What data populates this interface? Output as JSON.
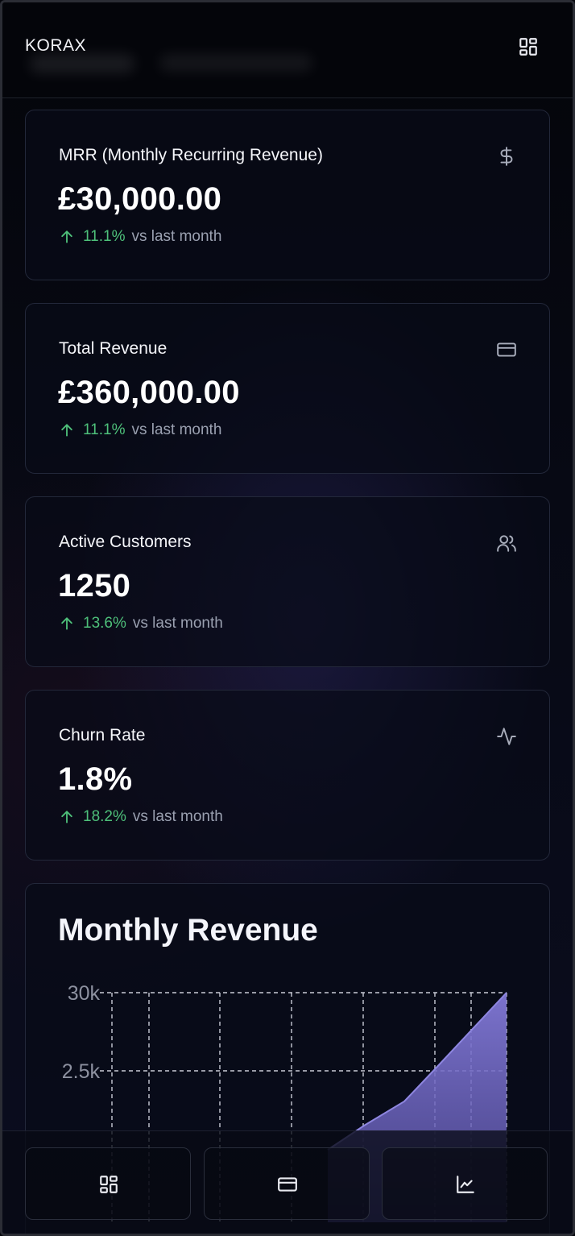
{
  "header": {
    "brand": "KORAX",
    "menu_icon": "dashboard-grid-icon"
  },
  "stats": [
    {
      "label": "MRR (Monthly Recurring Revenue)",
      "value": "£30,000.00",
      "change": "11.1%",
      "comparison": "vs last month",
      "icon": "dollar-icon",
      "trend": "up"
    },
    {
      "label": "Total Revenue",
      "value": "£360,000.00",
      "change": "11.1%",
      "comparison": "vs last month",
      "icon": "credit-card-icon",
      "trend": "up"
    },
    {
      "label": "Active Customers",
      "value": "1250",
      "change": "13.6%",
      "comparison": "vs last month",
      "icon": "users-icon",
      "trend": "up"
    },
    {
      "label": "Churn Rate",
      "value": "1.8%",
      "change": "18.2%",
      "comparison": "vs last month",
      "icon": "activity-icon",
      "trend": "up"
    }
  ],
  "colors": {
    "positive": "#4ec07a",
    "chart_fill": "#7b72c9",
    "chart_line": "#8e86e0"
  },
  "chart_data": {
    "type": "area",
    "title": "Monthly Revenue",
    "y_ticks": [
      "30k",
      "2.5k"
    ],
    "series": [
      {
        "values": [
          0,
          0,
          0,
          0,
          7500,
          15000,
          20000,
          30000
        ]
      }
    ],
    "grid": true
  },
  "bottom_nav": [
    {
      "icon": "dashboard-grid-icon"
    },
    {
      "icon": "credit-card-icon"
    },
    {
      "icon": "line-chart-icon"
    }
  ]
}
